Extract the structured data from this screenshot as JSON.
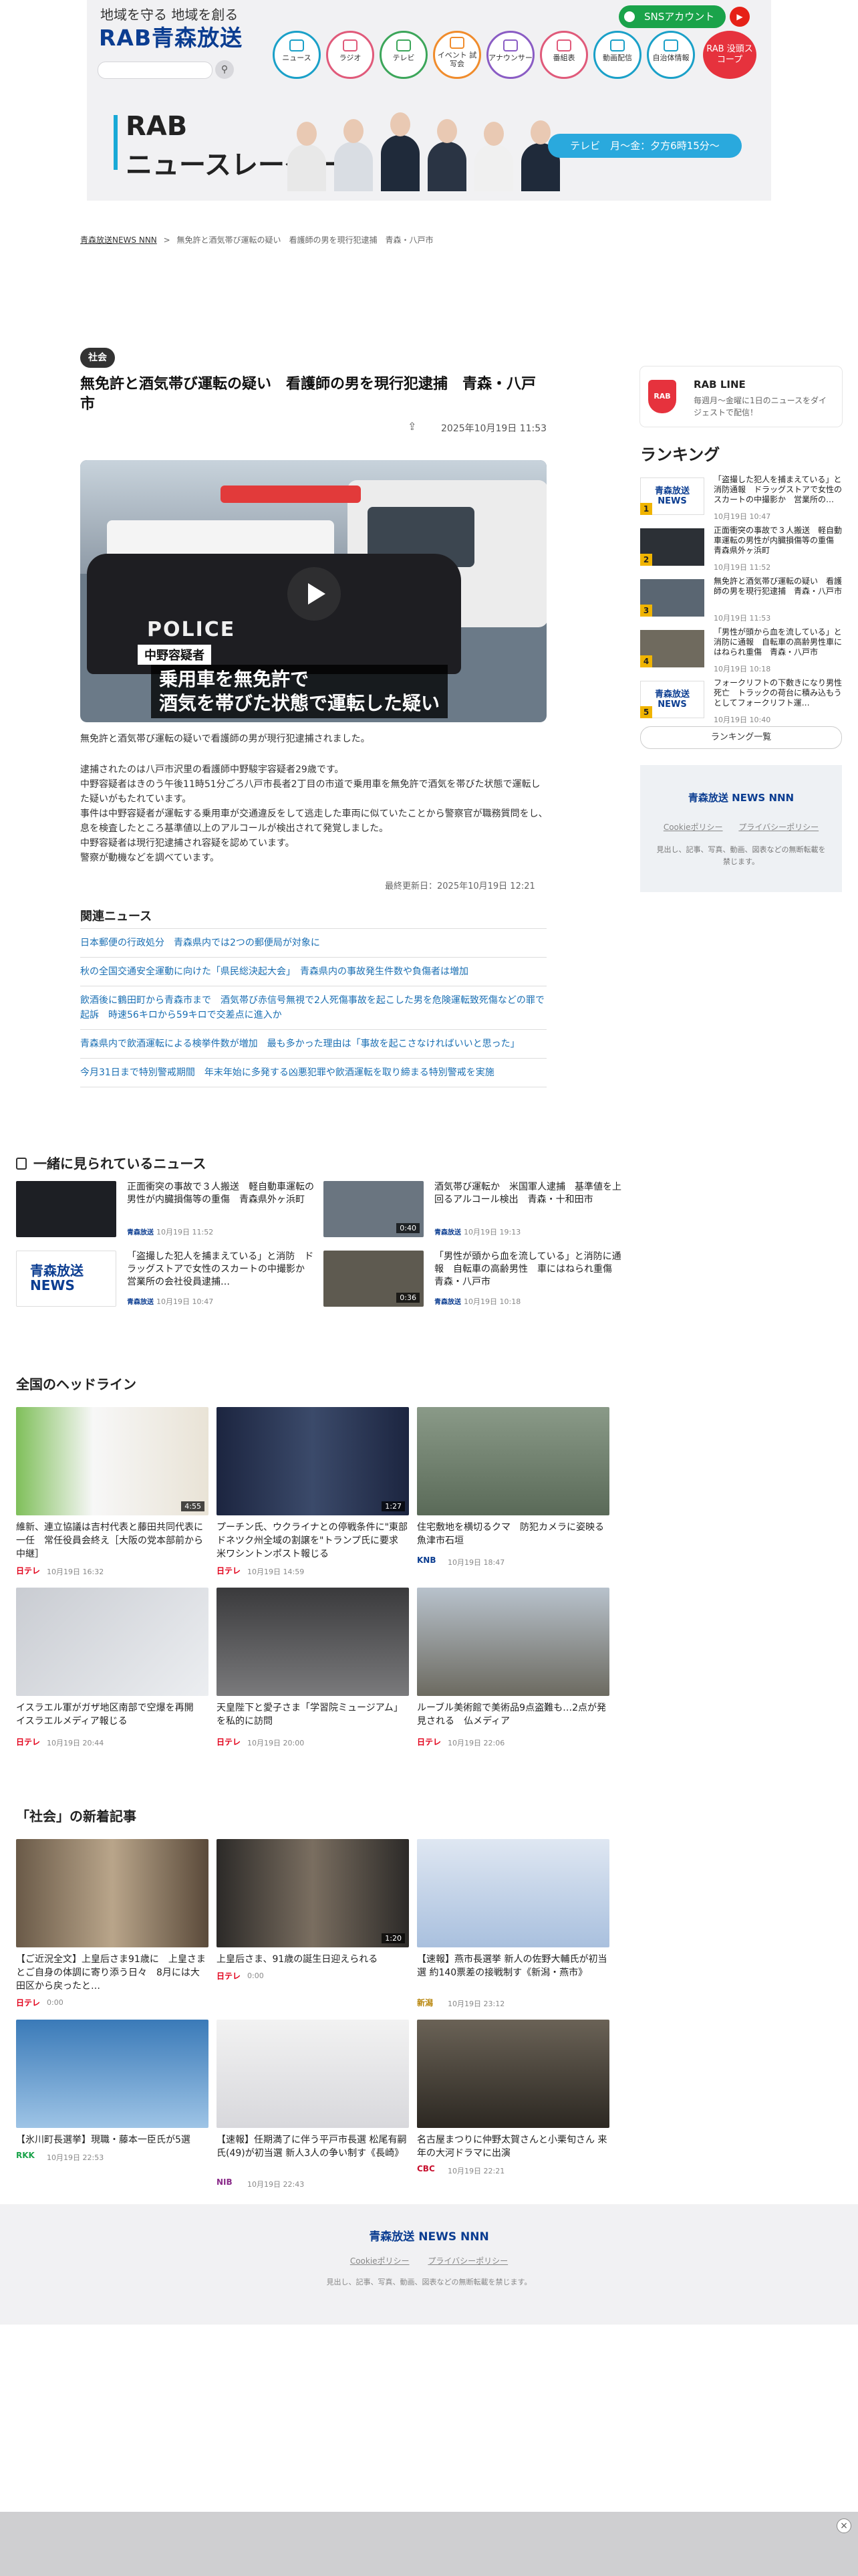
{
  "header": {
    "tagline": "地域を守る 地域を創る",
    "logo": "RAB青森放送",
    "sns_label": "SNSアカウント",
    "youtube": "▶",
    "nav": [
      "ニュース",
      "ラジオ",
      "テレビ",
      "イベント 試写会",
      "アナウンサー",
      "番組表",
      "動画配信",
      "自治体情報"
    ],
    "nav_colors": [
      "#1aa0c8",
      "#e05a7a",
      "#3ca65a",
      "#f08c2c",
      "#8a5cc4",
      "#e05a7a",
      "#1aa0c8",
      "#1aa0c8"
    ],
    "rab_scope": "RAB 没頭スコープ",
    "radar_title_1": "RAB",
    "radar_title_2": "ニュースレーダー",
    "radar_schedule": "テレビ　月～金：夕方6時15分～"
  },
  "breadcrumb": {
    "home": "青森放送NEWS NNN",
    "sep": ">",
    "current": "無免許と酒気帯び運転の疑い　看護師の男を現行犯逮捕　青森・八戸市"
  },
  "article": {
    "category": "社会",
    "title": "無免許と酒気帯び運転の疑い　看護師の男を現行犯逮捕　青森・八戸市",
    "share_icon": "⇪",
    "published": "2025年10月19日 11:53",
    "video_location": "中野容疑者",
    "video_caption_1": "乗用車を無免許で",
    "video_caption_2": "酒気を帯びた状態で運転した疑い",
    "video_police_text": "POLICE",
    "photo_caption": "無免許と酒気帯び運転の疑いで看護師の男が現行犯逮捕されました。",
    "paragraphs": [
      "逮捕されたのは八戸市沢里の看護師中野駿宇容疑者29歳です。",
      "中野容疑者はきのう午後11時51分ごろ八戸市長者2丁目の市道で乗用車を無免許で酒気を帯びた状態で運転した疑いがもたれています。",
      "事件は中野容疑者が運転する乗用車が交通違反をして逃走した車両に似ていたことから警察官が職務質問をし、息を検査したところ基準値以上のアルコールが検出されて発覚しました。",
      "中野容疑者は現行犯逮捕され容疑を認めています。",
      "警察が動機などを調べています。"
    ],
    "updated": "最終更新日：2025年10月19日 12:21"
  },
  "related": {
    "heading": "関連ニュース",
    "items": [
      "日本郵便の行政処分　青森県内では2つの郵便局が対象に",
      "秋の全国交通安全運動に向けた「県民総決起大会」　青森県内の事故発生件数や負傷者は増加",
      "飲酒後に鶴田町から青森市まで　酒気帯び赤信号無視で2人死傷事故を起こした男を危険運転致死傷などの罪で起訴　時速56キロから59キロで交差点に進入か",
      "青森県内で飲酒運転による検挙件数が増加　最も多かった理由は「事故を起こさなければいいと思った」",
      "今月31日まで特別警戒期間　年末年始に多発する凶悪犯罪や飲酒運転を取り締まる特別警戒を実施"
    ]
  },
  "sidebar": {
    "rabline_logo": "RAB",
    "rabline_title": "RAB LINE",
    "rabline_desc": "毎週月～金曜に1日のニュースをダイジェストで配信！",
    "ranking_heading": "ランキング",
    "ranking": [
      {
        "num": "1",
        "title": "「盗撮した犯人を捕まえている」と消防通報　ドラッグストアで女性のスカートの中撮影か　営業所の…",
        "date": "10月19日 10:47",
        "logo": "青森放送 NEWS"
      },
      {
        "num": "2",
        "title": "正面衝突の事故で３人搬送　軽自動車運転の男性が内臓損傷等の重傷　青森県外ヶ浜町",
        "date": "10月19日 11:52",
        "logo": ""
      },
      {
        "num": "3",
        "title": "無免許と酒気帯び運転の疑い　看護師の男を現行犯逮捕　青森・八戸市",
        "date": "10月19日 11:53",
        "logo": ""
      },
      {
        "num": "4",
        "title": "「男性が頭から血を流している」と消防に通報　自転車の高齢男性車にはねられ重傷　青森・八戸市",
        "date": "10月19日 10:18",
        "logo": ""
      },
      {
        "num": "5",
        "title": "フォークリフトの下敷きになり男性死亡　トラックの荷台に積み込もうとしてフォークリフト運…",
        "date": "10月19日 10:40",
        "logo": "青森放送 NEWS"
      }
    ],
    "ranking_more": "ランキング一覧",
    "footer_logo": "青森放送 NEWS NNN",
    "footer_links": [
      "Cookieポリシー",
      "プライバシーポリシー"
    ],
    "footer_copy": "見出し、記事、写真、動画、図表などの無断転載を禁じます。"
  },
  "seen_together": {
    "heading": "一緒に見られているニュース",
    "items": [
      {
        "title": "正面衝突の事故で３人搬送　軽自動車運転の男性が内臓損傷等の重傷　青森県外ヶ浜町",
        "source": "青森放送",
        "date": "10月19日 11:52",
        "logo": "",
        "duration": ""
      },
      {
        "title": "酒気帯び運転か　米国軍人逮捕　基準値を上回るアルコール検出　青森・十和田市",
        "source": "青森放送",
        "date": "10月19日 19:13",
        "logo": "",
        "duration": "0:40"
      },
      {
        "title": "「盗撮した犯人を捕まえている」と消防　ドラッグストアで女性のスカートの中撮影か　営業所の会社役員逮捕…",
        "source": "青森放送",
        "date": "10月19日 10:47",
        "logo": "青森放送 NEWS",
        "duration": ""
      },
      {
        "title": "「男性が頭から血を流している」と消防に通報　自転車の高齢男性　車にはねられ重傷　青森・八戸市",
        "source": "青森放送",
        "date": "10月19日 10:18",
        "logo": "",
        "duration": "0:36"
      }
    ]
  },
  "national": {
    "heading": "全国のヘッドライン",
    "items": [
      {
        "title": "維新、連立協議は吉村代表と藤田共同代表に一任　常任役員会終え［大阪の党本部前から中継］",
        "source": "日テレ",
        "date": "10月19日 16:32",
        "duration": "4:55"
      },
      {
        "title": "プーチン氏、ウクライナとの停戦条件に\"東部ドネツク州全域の割譲を\"トランプ氏に要求　米ワシントンポスト報じる",
        "source": "日テレ",
        "date": "10月19日 14:59",
        "duration": "1:27"
      },
      {
        "title": "住宅敷地を横切るクマ　防犯カメラに姿映る　魚津市石垣",
        "source": "KNB",
        "date": "10月19日 18:47",
        "duration": ""
      },
      {
        "title": "イスラエル軍がガザ地区南部で空爆を再開　イスラエルメディア報じる",
        "source": "日テレ",
        "date": "10月19日 20:44",
        "duration": ""
      },
      {
        "title": "天皇陛下と愛子さま「学習院ミュージアム」を私的に訪問",
        "source": "日テレ",
        "date": "10月19日 20:00",
        "duration": ""
      },
      {
        "title": "ルーブル美術館で美術品9点盗難も…2点が発見される　仏メディア",
        "source": "日テレ",
        "date": "10月19日 22:06",
        "duration": ""
      }
    ]
  },
  "society": {
    "heading": "「社会」の新着記事",
    "items": [
      {
        "title": "【ご近況全文】上皇后さま91歳に　上皇さまとご自身の体調に寄り添う日々　8月には大田区から戻ったと…",
        "source": "日テレ",
        "date": "0:00",
        "duration": ""
      },
      {
        "title": "上皇后さま、91歳の誕生日迎えられる",
        "source": "日テレ",
        "date": "0:00",
        "duration": "1:20"
      },
      {
        "title": "【速報】燕市長選挙 新人の佐野大輔氏が初当選 約140票差の接戦制す《新潟・燕市》",
        "source": "新潟",
        "date": "10月19日 23:12",
        "duration": ""
      },
      {
        "title": "【氷川町長選挙】現職・藤本一臣氏が5選",
        "source": "RKK",
        "date": "10月19日 22:53",
        "duration": ""
      },
      {
        "title": "【速報】任期満了に伴う平戸市長選 松尾有嗣氏(49)が初当選 新人3人の争い制す《長崎》",
        "source": "NIB",
        "date": "10月19日 22:43",
        "duration": ""
      },
      {
        "title": "名古屋まつりに仲野太賀さんと小栗旬さん 来年の大河ドラマに出演",
        "source": "CBC",
        "date": "10月19日 22:21",
        "duration": ""
      }
    ]
  },
  "footer": {
    "logo": "青森放送 NEWS NNN",
    "links": [
      "Cookieポリシー",
      "プライバシーポリシー"
    ],
    "copy": "見出し、記事、写真、動画、図表などの無断転載を禁じます。"
  },
  "ad": {
    "close": "×"
  }
}
